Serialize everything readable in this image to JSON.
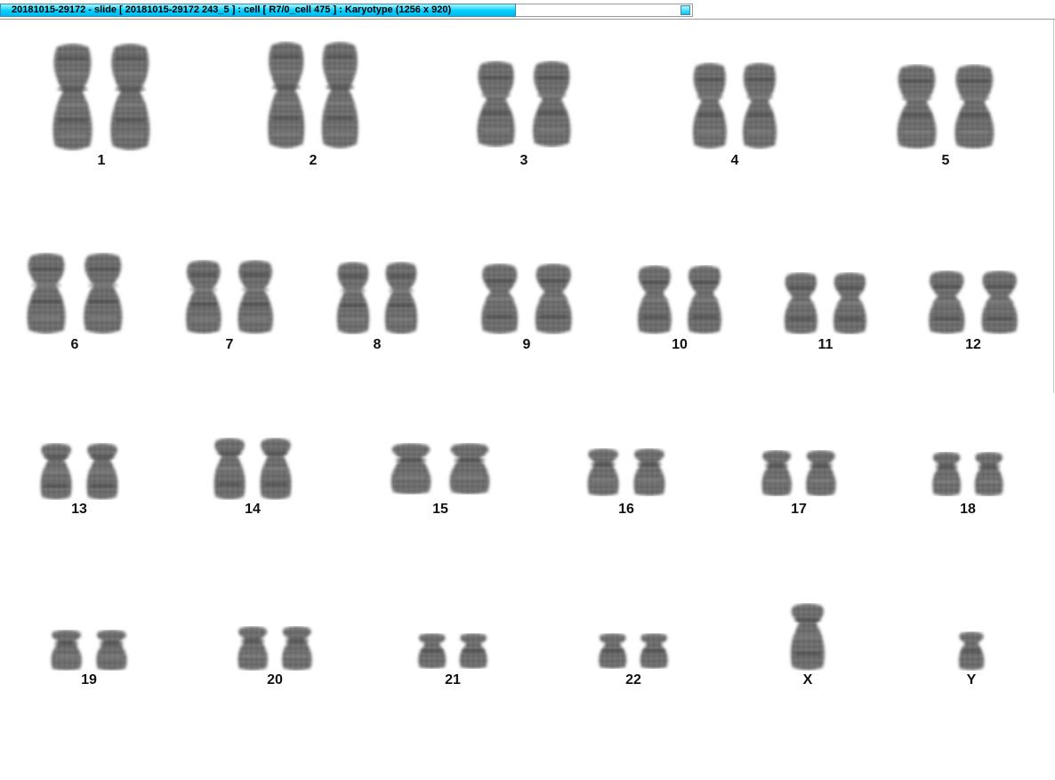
{
  "window": {
    "title": "20181015-29172 - slide [ 20181015-29172 243_5 ] : cell [ R7/0_cell 475 ] : Karyotype  (1256 x 920)"
  },
  "karyotype": {
    "groups": [
      {
        "label": "1"
      },
      {
        "label": "2"
      },
      {
        "label": "3"
      },
      {
        "label": "4"
      },
      {
        "label": "5"
      },
      {
        "label": "6"
      },
      {
        "label": "7"
      },
      {
        "label": "8"
      },
      {
        "label": "9"
      },
      {
        "label": "10"
      },
      {
        "label": "11"
      },
      {
        "label": "12"
      },
      {
        "label": "13"
      },
      {
        "label": "14"
      },
      {
        "label": "15"
      },
      {
        "label": "16"
      },
      {
        "label": "17"
      },
      {
        "label": "18"
      },
      {
        "label": "19"
      },
      {
        "label": "20"
      },
      {
        "label": "21"
      },
      {
        "label": "22"
      },
      {
        "label": "X"
      },
      {
        "label": "Y"
      }
    ]
  },
  "colors": {
    "title_tab": "#00cfff",
    "chromosome_dark": "#3c3c3c",
    "chromosome_light": "#8a8a8a",
    "background": "#ffffff"
  }
}
